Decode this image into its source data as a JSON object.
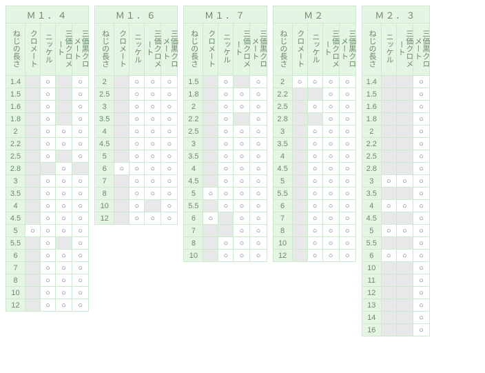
{
  "circle": "○",
  "row_header": "ねじの長さ",
  "finishes_4": [
    "クロメート",
    "ニッケル",
    "三価クロメート",
    "三価黒クロメート"
  ],
  "finishes_3": [
    "ニッケル",
    "三価クロメート",
    "三価黒クロメート"
  ],
  "tables": [
    {
      "title": "Ｍ１．４",
      "columns": "finishes_4",
      "rows": [
        {
          "len": "1.4",
          "cells": [
            "na",
            "avail",
            "na",
            "avail"
          ]
        },
        {
          "len": "1.5",
          "cells": [
            "na",
            "avail",
            "na",
            "avail"
          ]
        },
        {
          "len": "1.6",
          "cells": [
            "na",
            "avail",
            "na",
            "avail"
          ]
        },
        {
          "len": "1.8",
          "cells": [
            "na",
            "avail",
            "na",
            "avail"
          ]
        },
        {
          "len": "2",
          "cells": [
            "na",
            "avail",
            "avail",
            "avail"
          ]
        },
        {
          "len": "2.2",
          "cells": [
            "na",
            "avail",
            "avail",
            "avail"
          ]
        },
        {
          "len": "2.5",
          "cells": [
            "na",
            "avail",
            "na",
            "avail"
          ]
        },
        {
          "len": "2.8",
          "cells": [
            "na",
            "na",
            "avail",
            "na"
          ]
        },
        {
          "len": "3",
          "cells": [
            "na",
            "avail",
            "avail",
            "avail"
          ]
        },
        {
          "len": "3.5",
          "cells": [
            "na",
            "avail",
            "avail",
            "avail"
          ]
        },
        {
          "len": "4",
          "cells": [
            "na",
            "avail",
            "avail",
            "avail"
          ]
        },
        {
          "len": "4.5",
          "cells": [
            "na",
            "avail",
            "avail",
            "avail"
          ]
        },
        {
          "len": "5",
          "cells": [
            "avail",
            "avail",
            "avail",
            "avail"
          ]
        },
        {
          "len": "5.5",
          "cells": [
            "na",
            "avail",
            "na",
            "avail"
          ]
        },
        {
          "len": "6",
          "cells": [
            "na",
            "avail",
            "avail",
            "avail"
          ]
        },
        {
          "len": "7",
          "cells": [
            "na",
            "avail",
            "avail",
            "avail"
          ]
        },
        {
          "len": "8",
          "cells": [
            "na",
            "avail",
            "avail",
            "avail"
          ]
        },
        {
          "len": "10",
          "cells": [
            "na",
            "avail",
            "avail",
            "avail"
          ]
        },
        {
          "len": "12",
          "cells": [
            "na",
            "avail",
            "avail",
            "avail"
          ]
        }
      ]
    },
    {
      "title": "Ｍ１．６",
      "columns": "finishes_4",
      "rows": [
        {
          "len": "2",
          "cells": [
            "na",
            "avail",
            "avail",
            "avail"
          ]
        },
        {
          "len": "2.5",
          "cells": [
            "na",
            "avail",
            "avail",
            "avail"
          ]
        },
        {
          "len": "3",
          "cells": [
            "na",
            "avail",
            "avail",
            "avail"
          ]
        },
        {
          "len": "3.5",
          "cells": [
            "na",
            "avail",
            "avail",
            "avail"
          ]
        },
        {
          "len": "4",
          "cells": [
            "na",
            "avail",
            "avail",
            "avail"
          ]
        },
        {
          "len": "4.5",
          "cells": [
            "na",
            "avail",
            "avail",
            "avail"
          ]
        },
        {
          "len": "5",
          "cells": [
            "na",
            "avail",
            "avail",
            "avail"
          ]
        },
        {
          "len": "6",
          "cells": [
            "avail",
            "avail",
            "avail",
            "avail"
          ]
        },
        {
          "len": "7",
          "cells": [
            "na",
            "avail",
            "avail",
            "avail"
          ]
        },
        {
          "len": "8",
          "cells": [
            "na",
            "avail",
            "avail",
            "avail"
          ]
        },
        {
          "len": "10",
          "cells": [
            "na",
            "avail",
            "na",
            "avail"
          ]
        },
        {
          "len": "12",
          "cells": [
            "na",
            "avail",
            "avail",
            "avail"
          ]
        }
      ]
    },
    {
      "title": "Ｍ１．７",
      "columns": "finishes_4",
      "rows": [
        {
          "len": "1.5",
          "cells": [
            "na",
            "avail",
            "na",
            "avail"
          ]
        },
        {
          "len": "1.8",
          "cells": [
            "na",
            "avail",
            "avail",
            "avail"
          ]
        },
        {
          "len": "2",
          "cells": [
            "na",
            "avail",
            "avail",
            "avail"
          ]
        },
        {
          "len": "2.2",
          "cells": [
            "na",
            "avail",
            "na",
            "avail"
          ]
        },
        {
          "len": "2.5",
          "cells": [
            "na",
            "avail",
            "avail",
            "avail"
          ]
        },
        {
          "len": "3",
          "cells": [
            "na",
            "avail",
            "avail",
            "avail"
          ]
        },
        {
          "len": "3.5",
          "cells": [
            "na",
            "avail",
            "avail",
            "avail"
          ]
        },
        {
          "len": "4",
          "cells": [
            "na",
            "avail",
            "avail",
            "avail"
          ]
        },
        {
          "len": "4.5",
          "cells": [
            "na",
            "avail",
            "avail",
            "avail"
          ]
        },
        {
          "len": "5",
          "cells": [
            "avail",
            "avail",
            "avail",
            "avail"
          ]
        },
        {
          "len": "5.5",
          "cells": [
            "na",
            "avail",
            "avail",
            "avail"
          ]
        },
        {
          "len": "6",
          "cells": [
            "avail",
            "na",
            "avail",
            "avail"
          ]
        },
        {
          "len": "7",
          "cells": [
            "na",
            "na",
            "avail",
            "avail"
          ]
        },
        {
          "len": "8",
          "cells": [
            "na",
            "avail",
            "avail",
            "avail"
          ]
        },
        {
          "len": "10",
          "cells": [
            "na",
            "avail",
            "avail",
            "avail"
          ]
        }
      ]
    },
    {
      "title": "Ｍ２",
      "columns": "finishes_4",
      "rows": [
        {
          "len": "2",
          "cells": [
            "avail",
            "avail",
            "avail",
            "avail"
          ]
        },
        {
          "len": "2.2",
          "cells": [
            "na",
            "na",
            "avail",
            "avail"
          ]
        },
        {
          "len": "2.5",
          "cells": [
            "na",
            "avail",
            "avail",
            "avail"
          ]
        },
        {
          "len": "2.8",
          "cells": [
            "na",
            "na",
            "avail",
            "avail"
          ]
        },
        {
          "len": "3",
          "cells": [
            "na",
            "avail",
            "avail",
            "avail"
          ]
        },
        {
          "len": "3.5",
          "cells": [
            "na",
            "avail",
            "avail",
            "avail"
          ]
        },
        {
          "len": "4",
          "cells": [
            "na",
            "avail",
            "avail",
            "avail"
          ]
        },
        {
          "len": "4.5",
          "cells": [
            "na",
            "avail",
            "avail",
            "avail"
          ]
        },
        {
          "len": "5",
          "cells": [
            "na",
            "avail",
            "avail",
            "avail"
          ]
        },
        {
          "len": "5.5",
          "cells": [
            "na",
            "avail",
            "avail",
            "avail"
          ]
        },
        {
          "len": "6",
          "cells": [
            "na",
            "avail",
            "avail",
            "avail"
          ]
        },
        {
          "len": "7",
          "cells": [
            "na",
            "avail",
            "avail",
            "avail"
          ]
        },
        {
          "len": "8",
          "cells": [
            "na",
            "avail",
            "avail",
            "avail"
          ]
        },
        {
          "len": "10",
          "cells": [
            "na",
            "avail",
            "avail",
            "avail"
          ]
        },
        {
          "len": "12",
          "cells": [
            "na",
            "avail",
            "avail",
            "avail"
          ]
        }
      ]
    },
    {
      "title": "Ｍ２．３",
      "columns": "finishes_3",
      "rows": [
        {
          "len": "1.4",
          "cells": [
            "na",
            "na",
            "avail"
          ]
        },
        {
          "len": "1.5",
          "cells": [
            "na",
            "na",
            "avail"
          ]
        },
        {
          "len": "1.6",
          "cells": [
            "na",
            "na",
            "avail"
          ]
        },
        {
          "len": "1.8",
          "cells": [
            "na",
            "na",
            "avail"
          ]
        },
        {
          "len": "2",
          "cells": [
            "na",
            "na",
            "avail"
          ]
        },
        {
          "len": "2.2",
          "cells": [
            "na",
            "na",
            "avail"
          ]
        },
        {
          "len": "2.5",
          "cells": [
            "na",
            "na",
            "avail"
          ]
        },
        {
          "len": "2.8",
          "cells": [
            "na",
            "na",
            "avail"
          ]
        },
        {
          "len": "3",
          "cells": [
            "avail",
            "avail",
            "avail"
          ]
        },
        {
          "len": "3.5",
          "cells": [
            "na",
            "na",
            "avail"
          ]
        },
        {
          "len": "4",
          "cells": [
            "avail",
            "avail",
            "avail"
          ]
        },
        {
          "len": "4.5",
          "cells": [
            "na",
            "na",
            "avail"
          ]
        },
        {
          "len": "5",
          "cells": [
            "avail",
            "avail",
            "avail"
          ]
        },
        {
          "len": "5.5",
          "cells": [
            "na",
            "na",
            "avail"
          ]
        },
        {
          "len": "6",
          "cells": [
            "avail",
            "avail",
            "avail"
          ]
        },
        {
          "len": "10",
          "cells": [
            "na",
            "na",
            "avail"
          ]
        },
        {
          "len": "11",
          "cells": [
            "na",
            "na",
            "avail"
          ]
        },
        {
          "len": "12",
          "cells": [
            "na",
            "na",
            "avail"
          ]
        },
        {
          "len": "13",
          "cells": [
            "na",
            "na",
            "avail"
          ]
        },
        {
          "len": "14",
          "cells": [
            "na",
            "na",
            "avail"
          ]
        },
        {
          "len": "16",
          "cells": [
            "na",
            "na",
            "avail"
          ]
        }
      ]
    }
  ]
}
